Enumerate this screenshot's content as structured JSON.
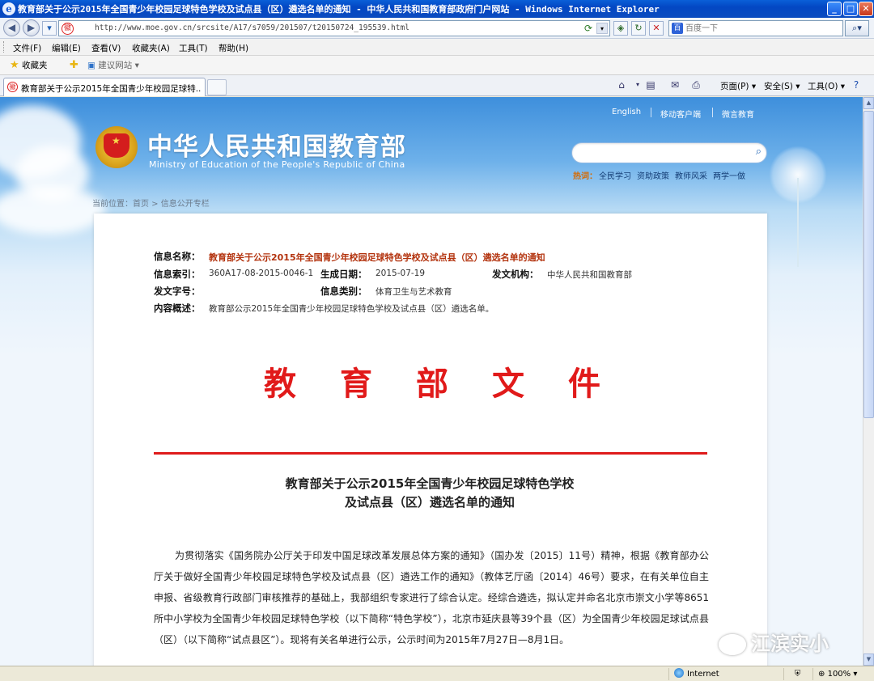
{
  "window": {
    "title": "教育部关于公示2015年全国青少年校园足球特色学校及试点县（区）遴选名单的通知 - 中华人民共和国教育部政府门户网站 - Windows Internet Explorer",
    "buttons": {
      "minimize": "_",
      "maximize": "□",
      "close": "✕"
    }
  },
  "address_bar": {
    "url": "http://www.moe.gov.cn/srcsite/A17/s7059/201507/t20150724_195539.html",
    "site_icon_text": "徽"
  },
  "search_box": {
    "placeholder": "百度一下",
    "button_label": "⌕▾"
  },
  "menu": [
    "文件(F)",
    "编辑(E)",
    "查看(V)",
    "收藏夹(A)",
    "工具(T)",
    "帮助(H)"
  ],
  "favorites_bar": {
    "favorites_label": "收藏夹",
    "suggested_sites_label": "建议网站 ▾"
  },
  "tab": {
    "label": "教育部关于公示2015年全国青少年校园足球特..."
  },
  "command_bar": {
    "page_label": "页面(P) ▾",
    "safety_label": "安全(S) ▾",
    "tools_label": "工具(O) ▾"
  },
  "site_header": {
    "name_cn": "中华人民共和国教育部",
    "name_en": "Ministry of Education of the People's Republic of China",
    "top_links": [
      "English",
      "移动客户端",
      "微言教育"
    ],
    "hot_label": "热词：",
    "hot_words": [
      "全民学习",
      "资助政策",
      "教师风采",
      "两学一做"
    ],
    "breadcrumb": "当前位置：首页 > 信息公开专栏"
  },
  "document_meta": {
    "name_label": "信息名称：",
    "name_value": "教育部关于公示2015年全国青少年校园足球特色学校及试点县（区）遴选名单的通知",
    "index_label": "信息索引：",
    "index_value": "360A17-08-2015-0046-1",
    "date_label": "生成日期：",
    "date_value": "2015-07-19",
    "issuer_label": "发文机构：",
    "issuer_value": "中华人民共和国教育部",
    "docno_label": "发文字号：",
    "docno_value": "",
    "category_label": "信息类别：",
    "category_value": "体育卫生与艺术教育",
    "summary_label": "内容概述：",
    "summary_value": "教育部公示2015年全国青少年校园足球特色学校及试点县（区）遴选名单。"
  },
  "document": {
    "red_heading": [
      "教",
      "育",
      "部",
      "文",
      "件"
    ],
    "title_line1": "教育部关于公示2015年全国青少年校园足球特色学校",
    "title_line2": "及试点县（区）遴选名单的通知",
    "body": "为贯彻落实《国务院办公厅关于印发中国足球改革发展总体方案的通知》（国办发〔2015〕11号）精神，根据《教育部办公厅关于做好全国青少年校园足球特色学校及试点县（区）遴选工作的通知》（教体艺厅函〔2014〕46号）要求，在有关单位自主申报、省级教育行政部门审核推荐的基础上，我部组织专家进行了综合认定。经综合遴选，拟认定并命名北京市崇文小学等8651所中小学校为全国青少年校园足球特色学校（以下简称“特色学校”），北京市延庆县等39个县（区）为全国青少年校园足球试点县（区）（以下简称“试点县区”）。现将有关名单进行公示，公示时间为2015年7月27日—8月1日。"
  },
  "watermark": "江滨实小",
  "status_bar": {
    "zone": "Internet",
    "zoom": "100%"
  },
  "colors": {
    "heading_red": "#e11a1a",
    "title_orange": "#b3330e",
    "xp_blue": "#0347c3"
  }
}
